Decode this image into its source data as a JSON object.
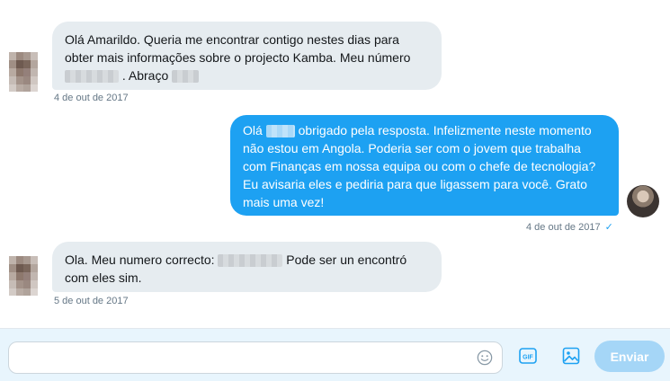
{
  "messages": [
    {
      "lines": [
        "Olá Amarildo. Queria me encontrar contigo nestes dias para",
        "obter mais informações sobre o projecto Kamba. Meu número",
        ". Abraço"
      ],
      "timestamp": "4 de out de 2017"
    },
    {
      "lines": [
        "Olá",
        "obrigado pela resposta. Infelizmente neste momento",
        "não estou em Angola. Poderia ser com o jovem que trabalha",
        "com Finanças em nossa equipa ou com o chefe de tecnologia?",
        "Eu avisaria eles e pediria para que ligassem para você. Grato",
        "mais uma vez!"
      ],
      "timestamp": "4 de out de 2017",
      "read_mark": "✓"
    },
    {
      "lines": [
        "Ola. Meu numero correcto:",
        "Pode ser un encontró",
        "com eles sim."
      ],
      "timestamp": "5 de out de 2017"
    }
  ],
  "composer": {
    "placeholder": "",
    "send_label": "Enviar",
    "gif_label": "GIF"
  },
  "colors": {
    "incoming_bubble": "#e6ecf0",
    "outgoing_bubble": "#1da1f2",
    "accent": "#1da1f2",
    "send_disabled": "#a5d6f7",
    "composer_bg": "#e8f5fd"
  },
  "icons": [
    "blurred-avatar",
    "user-avatar",
    "emoji-icon",
    "gif-icon",
    "image-icon",
    "check-icon"
  ]
}
